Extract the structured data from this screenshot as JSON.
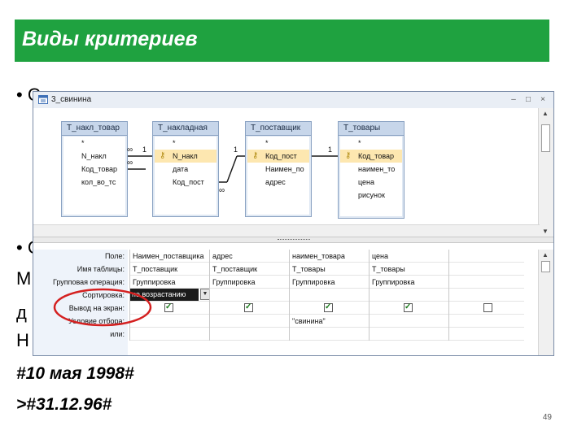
{
  "slide": {
    "title": "Виды критериев",
    "bullet_1": "• Сортировка данных в запросе",
    "bullet_2": "• С",
    "frag_1": "М",
    "frag_2": "д",
    "frag_3": "Н",
    "italic_1": "#10 мая 1998#",
    "italic_2": ">#31.12.96#",
    "page_number": "49"
  },
  "window": {
    "title": "3_свинина",
    "btn_min": "–",
    "btn_max": "□",
    "btn_close": "×"
  },
  "tables": [
    {
      "title": "Т_накл_товар",
      "fields": [
        "*",
        "N_накл",
        "Код_товар",
        "кол_во_тс"
      ]
    },
    {
      "title": "Т_накладная",
      "fields": [
        "*",
        "N_накл",
        "дата",
        "Код_пост"
      ],
      "key": 1
    },
    {
      "title": "Т_поставщик",
      "fields": [
        "*",
        "Код_пост",
        "Наимен_по",
        "адрес"
      ],
      "key": 1
    },
    {
      "title": "Т_товары",
      "fields": [
        "*",
        "Код_товар",
        "наимен_то",
        "цена",
        "рисунок"
      ],
      "key": 1
    }
  ],
  "relations": {
    "one_1": "1",
    "one_2": "1",
    "one_3": "1",
    "many_1": "∞",
    "many_2": "∞",
    "many_3": "∞"
  },
  "grid": {
    "row_labels": [
      "Поле:",
      "Имя таблицы:",
      "Групповая операция:",
      "Сортировка:",
      "Вывод на экран:",
      "Условие отбора:",
      "или:"
    ],
    "columns": [
      {
        "field": "Наимен_поставщика",
        "table": "Т_поставщик",
        "group": "Группировка",
        "sort": "по возрастанию",
        "show": true,
        "condition": ""
      },
      {
        "field": "адрес",
        "table": "Т_поставщик",
        "group": "Группировка",
        "sort": "",
        "show": true,
        "condition": ""
      },
      {
        "field": "наимен_товара",
        "table": "Т_товары",
        "group": "Группировка",
        "sort": "",
        "show": true,
        "condition": "\"свинина\""
      },
      {
        "field": "цена",
        "table": "Т_товары",
        "group": "Группировка",
        "sort": "",
        "show": true,
        "condition": ""
      },
      {
        "field": "",
        "table": "",
        "group": "",
        "sort": "",
        "show": false,
        "condition": ""
      }
    ]
  },
  "colors": {
    "title_green": "#1fa240",
    "highlight_circle": "#d42020"
  }
}
